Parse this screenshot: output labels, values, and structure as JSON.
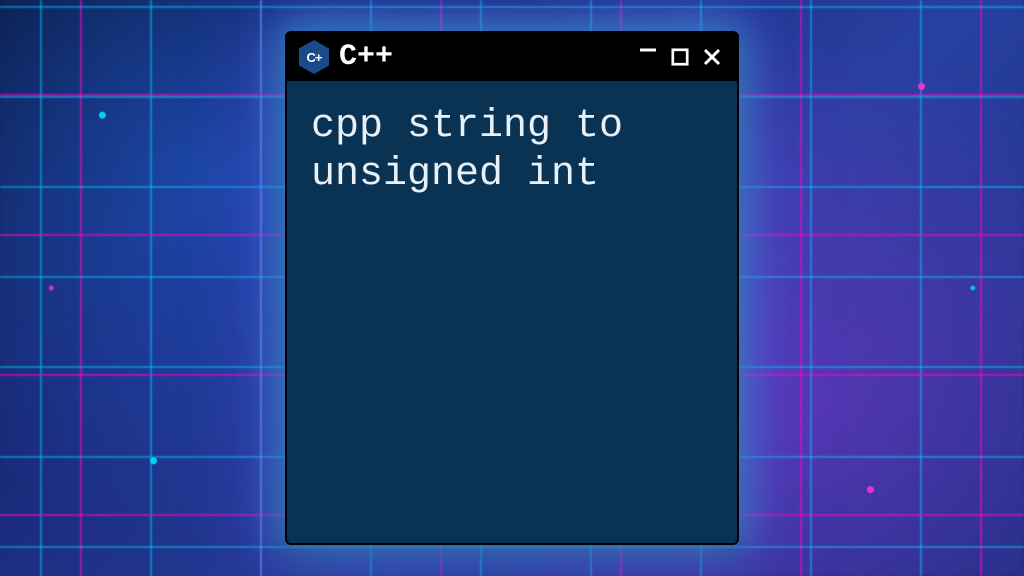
{
  "window": {
    "icon_label": "C+",
    "title": "C++",
    "content": "cpp string to unsigned int"
  },
  "controls": {
    "minimize": "−",
    "maximize": "□",
    "close": "✕"
  }
}
